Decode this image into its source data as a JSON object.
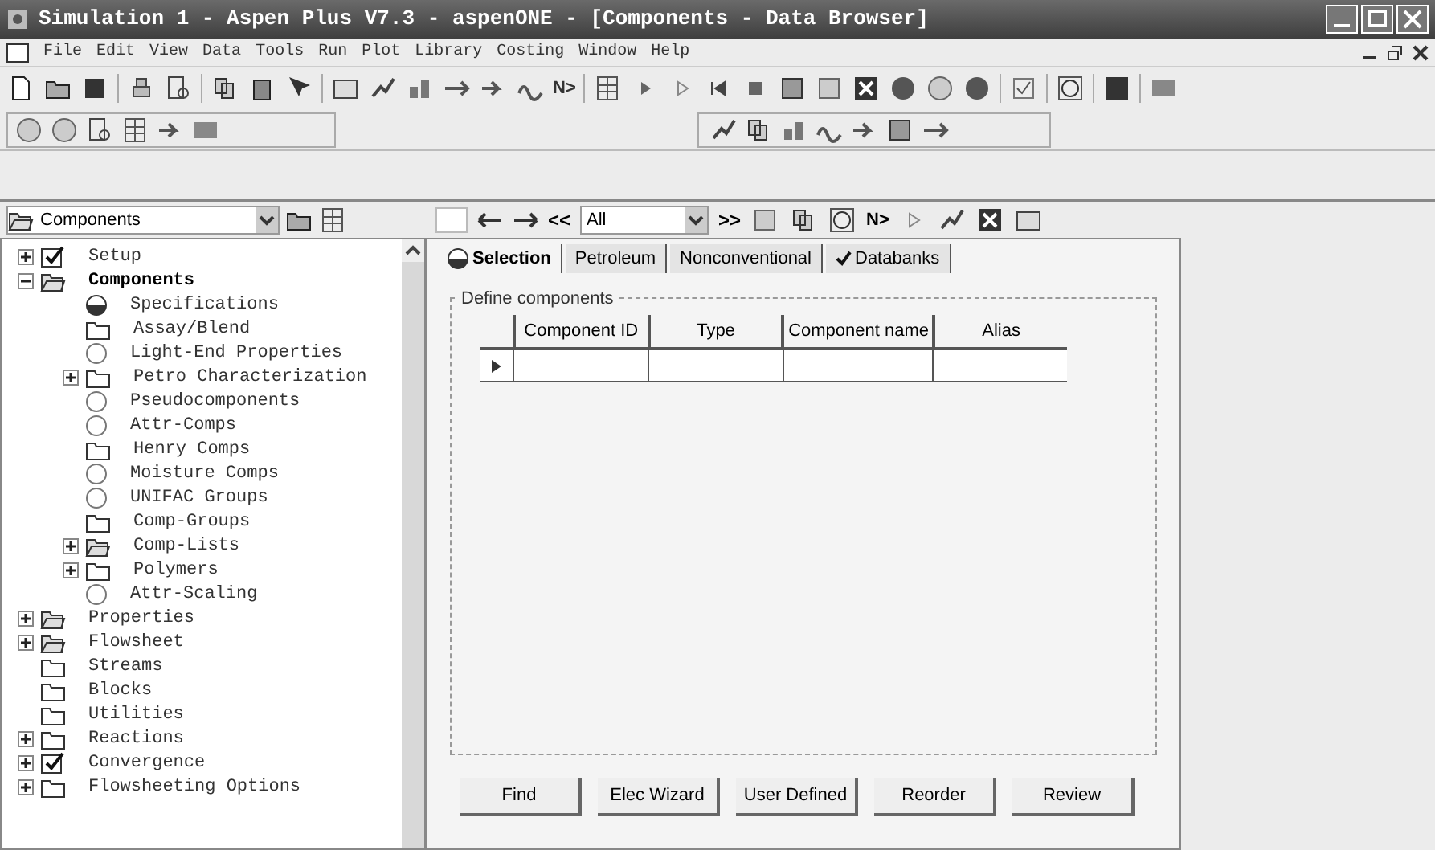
{
  "window": {
    "title": "Simulation 1 - Aspen Plus V7.3 - aspenONE - [Components - Data Browser]"
  },
  "menu": [
    "File",
    "Edit",
    "View",
    "Data",
    "Tools",
    "Run",
    "Plot",
    "Library",
    "Costing",
    "Window",
    "Help"
  ],
  "toolbar": {
    "next_label": "N>"
  },
  "browser_nav": {
    "folder": "Components",
    "back_label": "<<",
    "filter": "All",
    "forward_label": ">>",
    "next_label": "N>"
  },
  "tree": [
    {
      "label": "Setup",
      "kind": "form",
      "expandable": true,
      "expanded": false,
      "selected": false
    },
    {
      "label": "Components",
      "kind": "openfolder",
      "expandable": true,
      "expanded": true,
      "selected": true,
      "children": [
        {
          "label": "Specifications",
          "kind": "partial",
          "expandable": false,
          "selected": false
        },
        {
          "label": "Assay/Blend",
          "kind": "folder",
          "expandable": false,
          "selected": false
        },
        {
          "label": "Light-End Properties",
          "kind": "empty",
          "expandable": false,
          "selected": false
        },
        {
          "label": "Petro Characterization",
          "kind": "folder",
          "expandable": true,
          "expanded": false,
          "selected": false
        },
        {
          "label": "Pseudocomponents",
          "kind": "empty",
          "expandable": false,
          "selected": false
        },
        {
          "label": "Attr-Comps",
          "kind": "empty",
          "expandable": false,
          "selected": false
        },
        {
          "label": "Henry Comps",
          "kind": "folder",
          "expandable": false,
          "selected": false
        },
        {
          "label": "Moisture Comps",
          "kind": "empty",
          "expandable": false,
          "selected": false
        },
        {
          "label": "UNIFAC Groups",
          "kind": "empty",
          "expandable": false,
          "selected": false
        },
        {
          "label": "Comp-Groups",
          "kind": "folder",
          "expandable": false,
          "selected": false
        },
        {
          "label": "Comp-Lists",
          "kind": "openfolder",
          "expandable": true,
          "expanded": false,
          "selected": false
        },
        {
          "label": "Polymers",
          "kind": "folder",
          "expandable": true,
          "expanded": false,
          "selected": false
        },
        {
          "label": "Attr-Scaling",
          "kind": "empty",
          "expandable": false,
          "selected": false
        }
      ]
    },
    {
      "label": "Properties",
      "kind": "openfolder",
      "expandable": true,
      "expanded": false,
      "selected": false
    },
    {
      "label": "Flowsheet",
      "kind": "openfolder",
      "expandable": true,
      "expanded": false,
      "selected": false
    },
    {
      "label": "Streams",
      "kind": "folder",
      "expandable": false,
      "selected": false
    },
    {
      "label": "Blocks",
      "kind": "folder",
      "expandable": false,
      "selected": false
    },
    {
      "label": "Utilities",
      "kind": "folder",
      "expandable": false,
      "selected": false
    },
    {
      "label": "Reactions",
      "kind": "folder",
      "expandable": true,
      "expanded": false,
      "selected": false
    },
    {
      "label": "Convergence",
      "kind": "form",
      "expandable": true,
      "expanded": false,
      "selected": false
    },
    {
      "label": "Flowsheeting Options",
      "kind": "folder",
      "expandable": true,
      "expanded": false,
      "selected": false
    }
  ],
  "tabs": [
    {
      "label": "Selection",
      "kind": "partial",
      "selected": true
    },
    {
      "label": "Petroleum",
      "kind": "plain",
      "selected": false
    },
    {
      "label": "Nonconventional",
      "kind": "plain",
      "selected": false
    },
    {
      "label": "Databanks",
      "kind": "complete",
      "selected": false
    }
  ],
  "group": {
    "title": "Define components",
    "columns": [
      "Component ID",
      "Type",
      "Component name",
      "Alias"
    ]
  },
  "buttons": [
    "Find",
    "Elec Wizard",
    "User Defined",
    "Reorder",
    "Review"
  ]
}
